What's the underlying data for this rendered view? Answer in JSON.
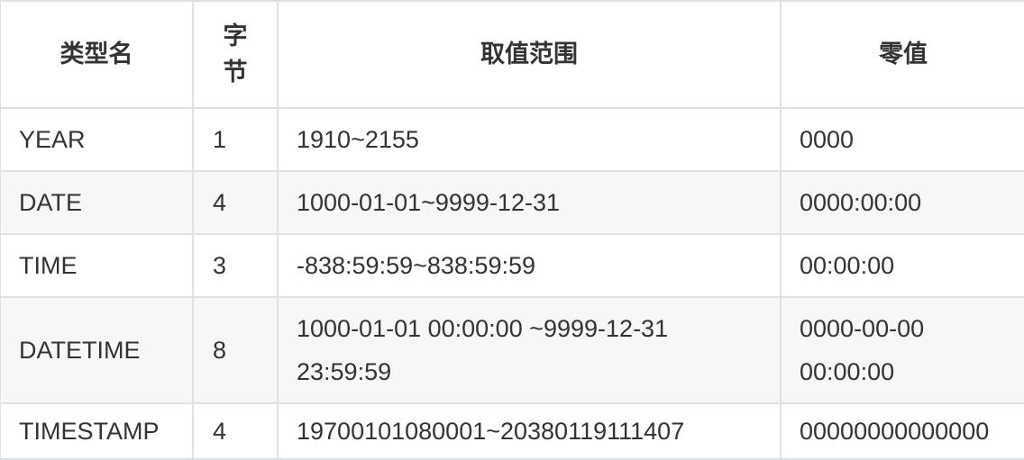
{
  "table": {
    "headers": [
      "类型名",
      "字节",
      "取值范围",
      "零值"
    ],
    "rows": [
      {
        "type": "YEAR",
        "bytes": "1",
        "range": "1910~2155",
        "zero": "0000"
      },
      {
        "type": "DATE",
        "bytes": "4",
        "range": "1000-01-01~9999-12-31",
        "zero": "0000:00:00"
      },
      {
        "type": "TIME",
        "bytes": "3",
        "range": "-838:59:59~838:59:59",
        "zero": "00:00:00"
      },
      {
        "type": "DATETIME",
        "bytes": "8",
        "range": "1000-01-01 00:00:00 ~9999-12-31 23:59:59",
        "zero": "0000-00-00 00:00:00"
      },
      {
        "type": "TIMESTAMP",
        "bytes": "4",
        "range": "19700101080001~20380119111407",
        "zero": "00000000000000"
      }
    ]
  }
}
